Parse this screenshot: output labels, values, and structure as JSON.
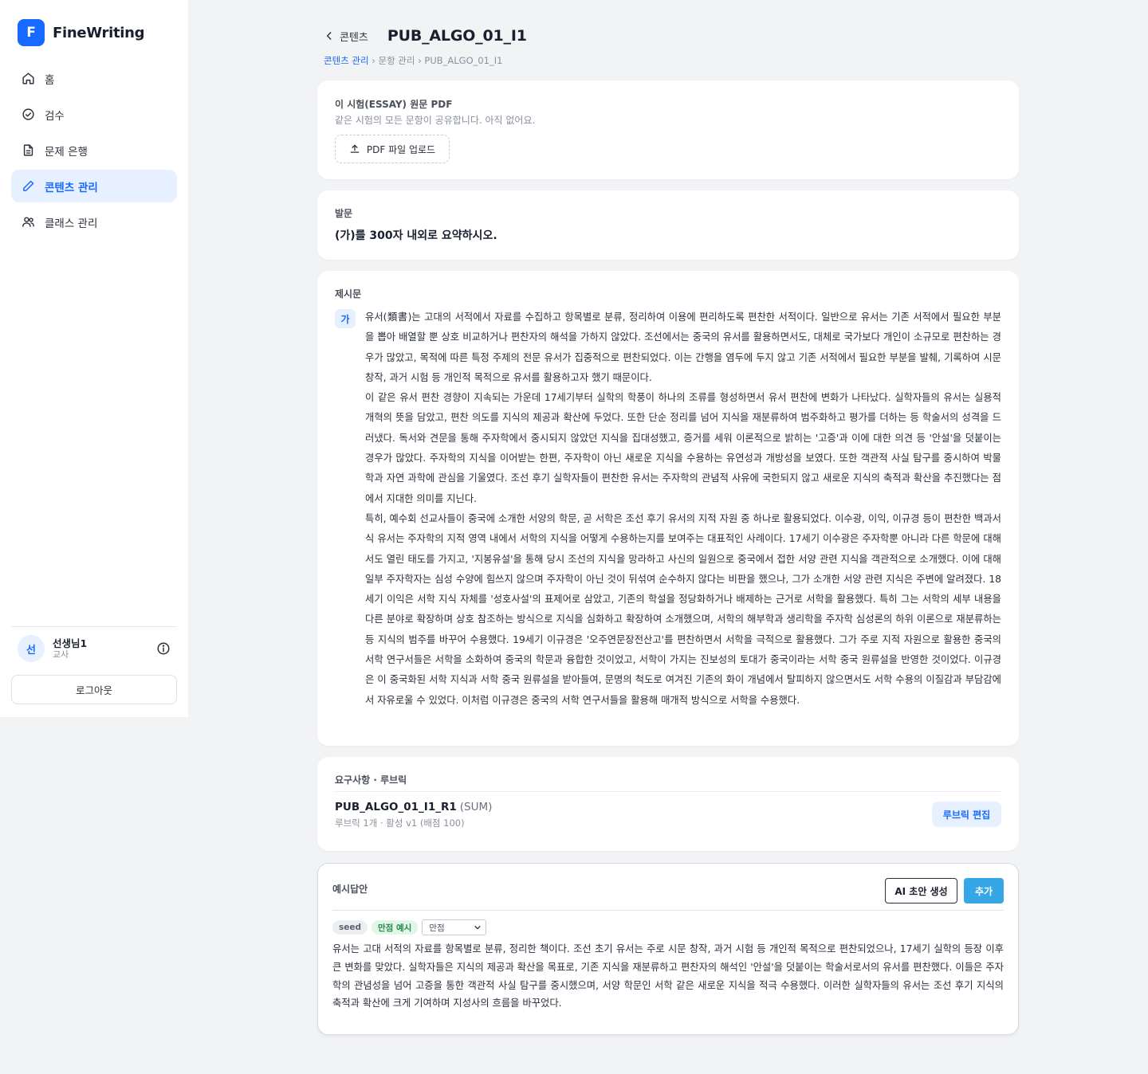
{
  "app": {
    "logo_letter": "F",
    "name": "FineWriting",
    "accent": "#1769ff"
  },
  "sidebar": {
    "items": [
      {
        "label": "홈",
        "icon": "home-icon"
      },
      {
        "label": "검수",
        "icon": "check-circle-icon"
      },
      {
        "label": "문제 은행",
        "icon": "document-icon"
      },
      {
        "label": "콘텐츠 관리",
        "icon": "pencil-icon",
        "active": true
      },
      {
        "label": "클래스 관리",
        "icon": "users-icon"
      }
    ],
    "user": {
      "avatar": "선",
      "name": "선생님1",
      "role": "교사"
    },
    "logout_label": "로그아웃"
  },
  "header": {
    "back_label": "콘텐츠",
    "title": "PUB_ALGO_01_I1",
    "breadcrumb": {
      "link": "콘텐츠 관리",
      "sep1": " › ",
      "mid": "문항 관리",
      "sep2": " › ",
      "current": "PUB_ALGO_01_I1"
    }
  },
  "pdf_section": {
    "label": "이 시험(ESSAY) 원문 PDF",
    "description": "같은 시험의 모든 문항이 공유합니다. 아직 없어요.",
    "upload_label": "PDF 파일 업로드"
  },
  "prompt_section": {
    "label": "발문",
    "question": "(가)를 300자 내외로 요약하시오."
  },
  "passage_section": {
    "label": "제시문",
    "tag": "가",
    "paragraphs": [
      "유서(類書)는 고대의 서적에서 자료를 수집하고 항목별로 분류, 정리하여 이용에 편리하도록 편찬한 서적이다. 일반으로 유서는 기존 서적에서 필요한 부분을 뽑아 배열할 뿐 상호 비교하거나 편찬자의 해석을 가하지 않았다. 조선에서는 중국의 유서를 활용하면서도, 대체로 국가보다 개인이 소규모로 편찬하는 경우가 많았고, 목적에 따른 특정 주제의 전문 유서가 집중적으로 편찬되었다. 이는 간행을 염두에 두지 않고 기존 서적에서 필요한 부분을 발췌, 기록하여 시문 창작, 과거 시험 등 개인적 목적으로 유서를 활용하고자 했기 때문이다.",
      "이 같은 유서 편찬 경향이 지속되는 가운데 17세기부터 실학의 학풍이 하나의 조류를 형성하면서 유서 편찬에 변화가 나타났다. 실학자들의 유서는 실용적 개혁의 뜻을 담았고, 편찬 의도를 지식의 제공과 확산에 두었다. 또한 단순 정리를 넘어 지식을 재분류하여 범주화하고 평가를 더하는 등 학술서의 성격을 드러냈다. 독서와 견문을 통해 주자학에서 중시되지 않았던 지식을 집대성했고, 증거를 세워 이론적으로 밝히는 '고증'과 이에 대한 의견 등 '안설'을 덧붙이는 경우가 많았다. 주자학의 지식을 이어받는 한편, 주자학이 아닌 새로운 지식을 수용하는 유연성과 개방성을 보였다. 또한 객관적 사실 탐구를 중시하여 박물학과 자연 과학에 관심을 기울였다. 조선 후기 실학자들이 편찬한 유서는 주자학의 관념적 사유에 국한되지 않고 새로운 지식의 축적과 확산을 추진했다는 점에서 지대한 의미를 지닌다.",
      "특히, 예수회 선교사들이 중국에 소개한 서양의 학문, 곧 서학은 조선 후기 유서의 지적 자원 중 하나로 활용되었다. 이수광, 이익, 이규경 등이 편찬한 백과서식 유서는 주자학의 지적 영역 내에서 서학의 지식을 어떻게 수용하는지를 보여주는 대표적인 사례이다. 17세기 이수광은 주자학뿐 아니라 다른 학문에 대해서도 열린 태도를 가지고, '지봉유설'을 통해 당시 조선의 지식을 망라하고 사신의 일원으로 중국에서 접한 서양 관련 지식을 객관적으로 소개했다. 이에 대해 일부 주자학자는 심성 수양에 힘쓰지 않으며 주자학이 아닌 것이 뒤섞여 순수하지 않다는 비판을 했으나, 그가 소개한 서양 관련 지식은 주변에 알려졌다. 18세기 이익은 서학 지식 자체를 '성호사설'의 표제어로 삼았고, 기존의 학설을 정당화하거나 배제하는 근거로 서학을 활용했다. 특히 그는 서학의 세부 내용을 다른 분야로 확장하며 상호 참조하는 방식으로 지식을 심화하고 확장하여 소개했으며, 서학의 해부학과 생리학을 주자학 심성론의 하위 이론으로 재분류하는 등 지식의 범주를 바꾸어 수용했다. 19세기 이규경은 '오주연문장전산고'를 편찬하면서 서학을 극적으로 활용했다. 그가 주로 지적 자원으로 활용한 중국의 서학 연구서들은 서학을 소화하여 중국의 학문과 융합한 것이었고, 서학이 가지는 진보성의 토대가 중국이라는 서학 중국 원류설을 반영한 것이었다. 이규경은 이 중국화된 서학 지식과 서학 중국 원류설을 받아들여, 문명의 척도로 여겨진 기존의 화이 개념에서 탈피하지 않으면서도 서학 수용의 이질감과 부담감에서 자유로울 수 있었다. 이처럼 이규경은 중국의 서학 연구서들을 활용해 매개적 방식으로 서학을 수용했다."
    ]
  },
  "rubric_section": {
    "label": "요구사항 · 루브릭",
    "rubric_id": "PUB_ALGO_01_I1_R1",
    "mode": "(SUM)",
    "meta": "루브릭 1개 · 활성 v1 (배점 100)",
    "edit_label": "루브릭 편집"
  },
  "answer_section": {
    "label": "예시답안",
    "ai_label": "AI 초안 생성",
    "add_label": "추가",
    "badge_seed": "seed",
    "badge_full": "만점 예시",
    "select_value": "만점",
    "text": "유서는 고대 서적의 자료를 항목별로 분류, 정리한 책이다. 조선 초기 유서는 주로 시문 창작, 과거 시험 등 개인적 목적으로 편찬되었으나, 17세기 실학의 등장 이후 큰 변화를 맞았다. 실학자들은 지식의 제공과 확산을 목표로, 기존 지식을 재분류하고 편찬자의 해석인 '안설'을 덧붙이는 학술서로서의 유서를 편찬했다. 이들은 주자학의 관념성을 넘어 고증을 통한 객관적 사실 탐구를 중시했으며, 서양 학문인 서학 같은 새로운 지식을 적극 수용했다. 이러한 실학자들의 유서는 조선 후기 지식의 축적과 확산에 크게 기여하며 지성사의 흐름을 바꾸었다."
  }
}
